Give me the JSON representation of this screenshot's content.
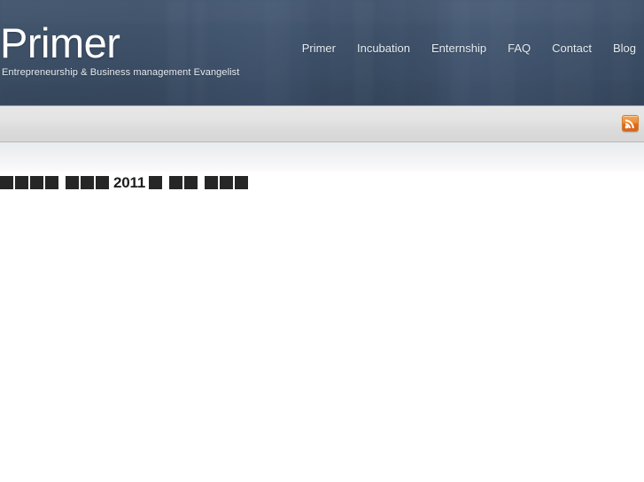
{
  "header": {
    "brand_title": "Primer",
    "brand_tagline": "Entrepreneurship & Business management Evangelist",
    "background_color": "#3b4f68",
    "nav": [
      {
        "label": "Primer"
      },
      {
        "label": "Incubation"
      },
      {
        "label": "Enternship"
      },
      {
        "label": "FAQ"
      },
      {
        "label": "Contact"
      },
      {
        "label": "Blog"
      }
    ]
  },
  "toolbar": {
    "rss_icon": "rss-icon",
    "rss_color": "#e8801f"
  },
  "main": {
    "post_heading": {
      "year": "2011",
      "missing_glyph_groups_before": [
        4,
        3
      ],
      "missing_glyph_groups_after": [
        1,
        2,
        3
      ],
      "glyph_color": "#262626"
    }
  }
}
